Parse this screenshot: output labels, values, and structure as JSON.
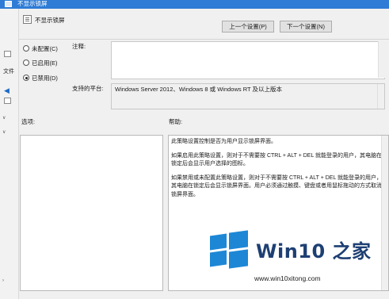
{
  "window": {
    "title": "不显示锁屏"
  },
  "background": {
    "partial_label": "文件"
  },
  "header": {
    "policy_name": "不显示锁屏",
    "prev_setting_label": "上一个设置(P)",
    "next_setting_label": "下一个设置(N)"
  },
  "state_options": [
    {
      "label": "未配置(C)",
      "checked": false
    },
    {
      "label": "已启用(E)",
      "checked": false
    },
    {
      "label": "已禁用(D)",
      "checked": true
    }
  ],
  "comment": {
    "label": "注释:",
    "value": ""
  },
  "supported_on": {
    "label": "支持的平台:",
    "value": "Windows Server 2012、Windows 8 或 Windows RT 及以上版本"
  },
  "options": {
    "label": "选项:"
  },
  "help": {
    "label": "帮助:",
    "paragraphs": [
      "此策略设置控制是否为用户显示锁屏界面。",
      "如果启用此策略设置，则对于不需要按 CTRL + ALT + DEL 就能登录的用户，其电脑在锁定后会显示用户选择的图标。",
      "如果禁用或未配置此策略设置，则对于不需要按 CTRL + ALT + DEL 就能登录的用户，其电脑在锁定后会显示锁屏界面。用户必须通过触摸、键盘或者用鼠标拖动的方式取消锁屏界面。"
    ]
  },
  "watermark": {
    "title": "Win10 之家",
    "url": "www.win10xitong.com"
  }
}
